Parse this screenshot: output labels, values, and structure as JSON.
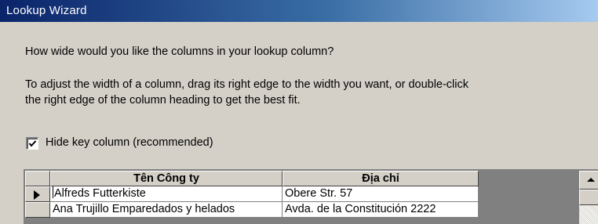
{
  "window": {
    "title": "Lookup Wizard"
  },
  "question": "How wide would you like the columns in your lookup column?",
  "instructions": [
    "To adjust the width of a column, drag its right edge to the width you want, or double-click",
    "the right edge of the column heading to get the best fit."
  ],
  "hide_key_column": {
    "label": "Hide key column (recommended)",
    "checked": true
  },
  "grid": {
    "columns": [
      "Tên Công ty",
      "Địa chỉ"
    ],
    "rows": [
      [
        "Alfreds Futterkiste",
        "Obere Str. 57"
      ],
      [
        "Ana Trujillo Emparedados y helados",
        "Avda. de la Constitución 2222"
      ]
    ],
    "current_row": 0
  },
  "icons": {
    "checkbox": "check-icon",
    "row_selector": "current-row-arrow-icon",
    "scroll_up": "scroll-up-arrow-icon"
  }
}
